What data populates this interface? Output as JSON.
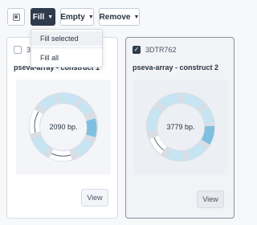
{
  "toolbar": {
    "select_icon": "select-toggle-icon",
    "fill_label": "Fill",
    "empty_label": "Empty",
    "remove_label": "Remove",
    "caret_icon": "caret-down-icon"
  },
  "fill_menu": {
    "items": [
      "Fill selected",
      "Fill all"
    ],
    "highlighted": "Fill selected"
  },
  "cards": [
    {
      "id_tag": "3",
      "checked": false,
      "title": "pseva-array - construct 1",
      "length": "2090 bp.",
      "view_label": "View"
    },
    {
      "id_tag": "3DTR762",
      "checked": true,
      "title": "pseva-array - construct 2",
      "length": "3779 bp.",
      "view_label": "View"
    }
  ],
  "colors": {
    "feature_light": "#bfe0f0",
    "feature_dark": "#7fbfe0",
    "feature_outline": "#9fb0c0",
    "active_button": "#2f3a4c"
  }
}
